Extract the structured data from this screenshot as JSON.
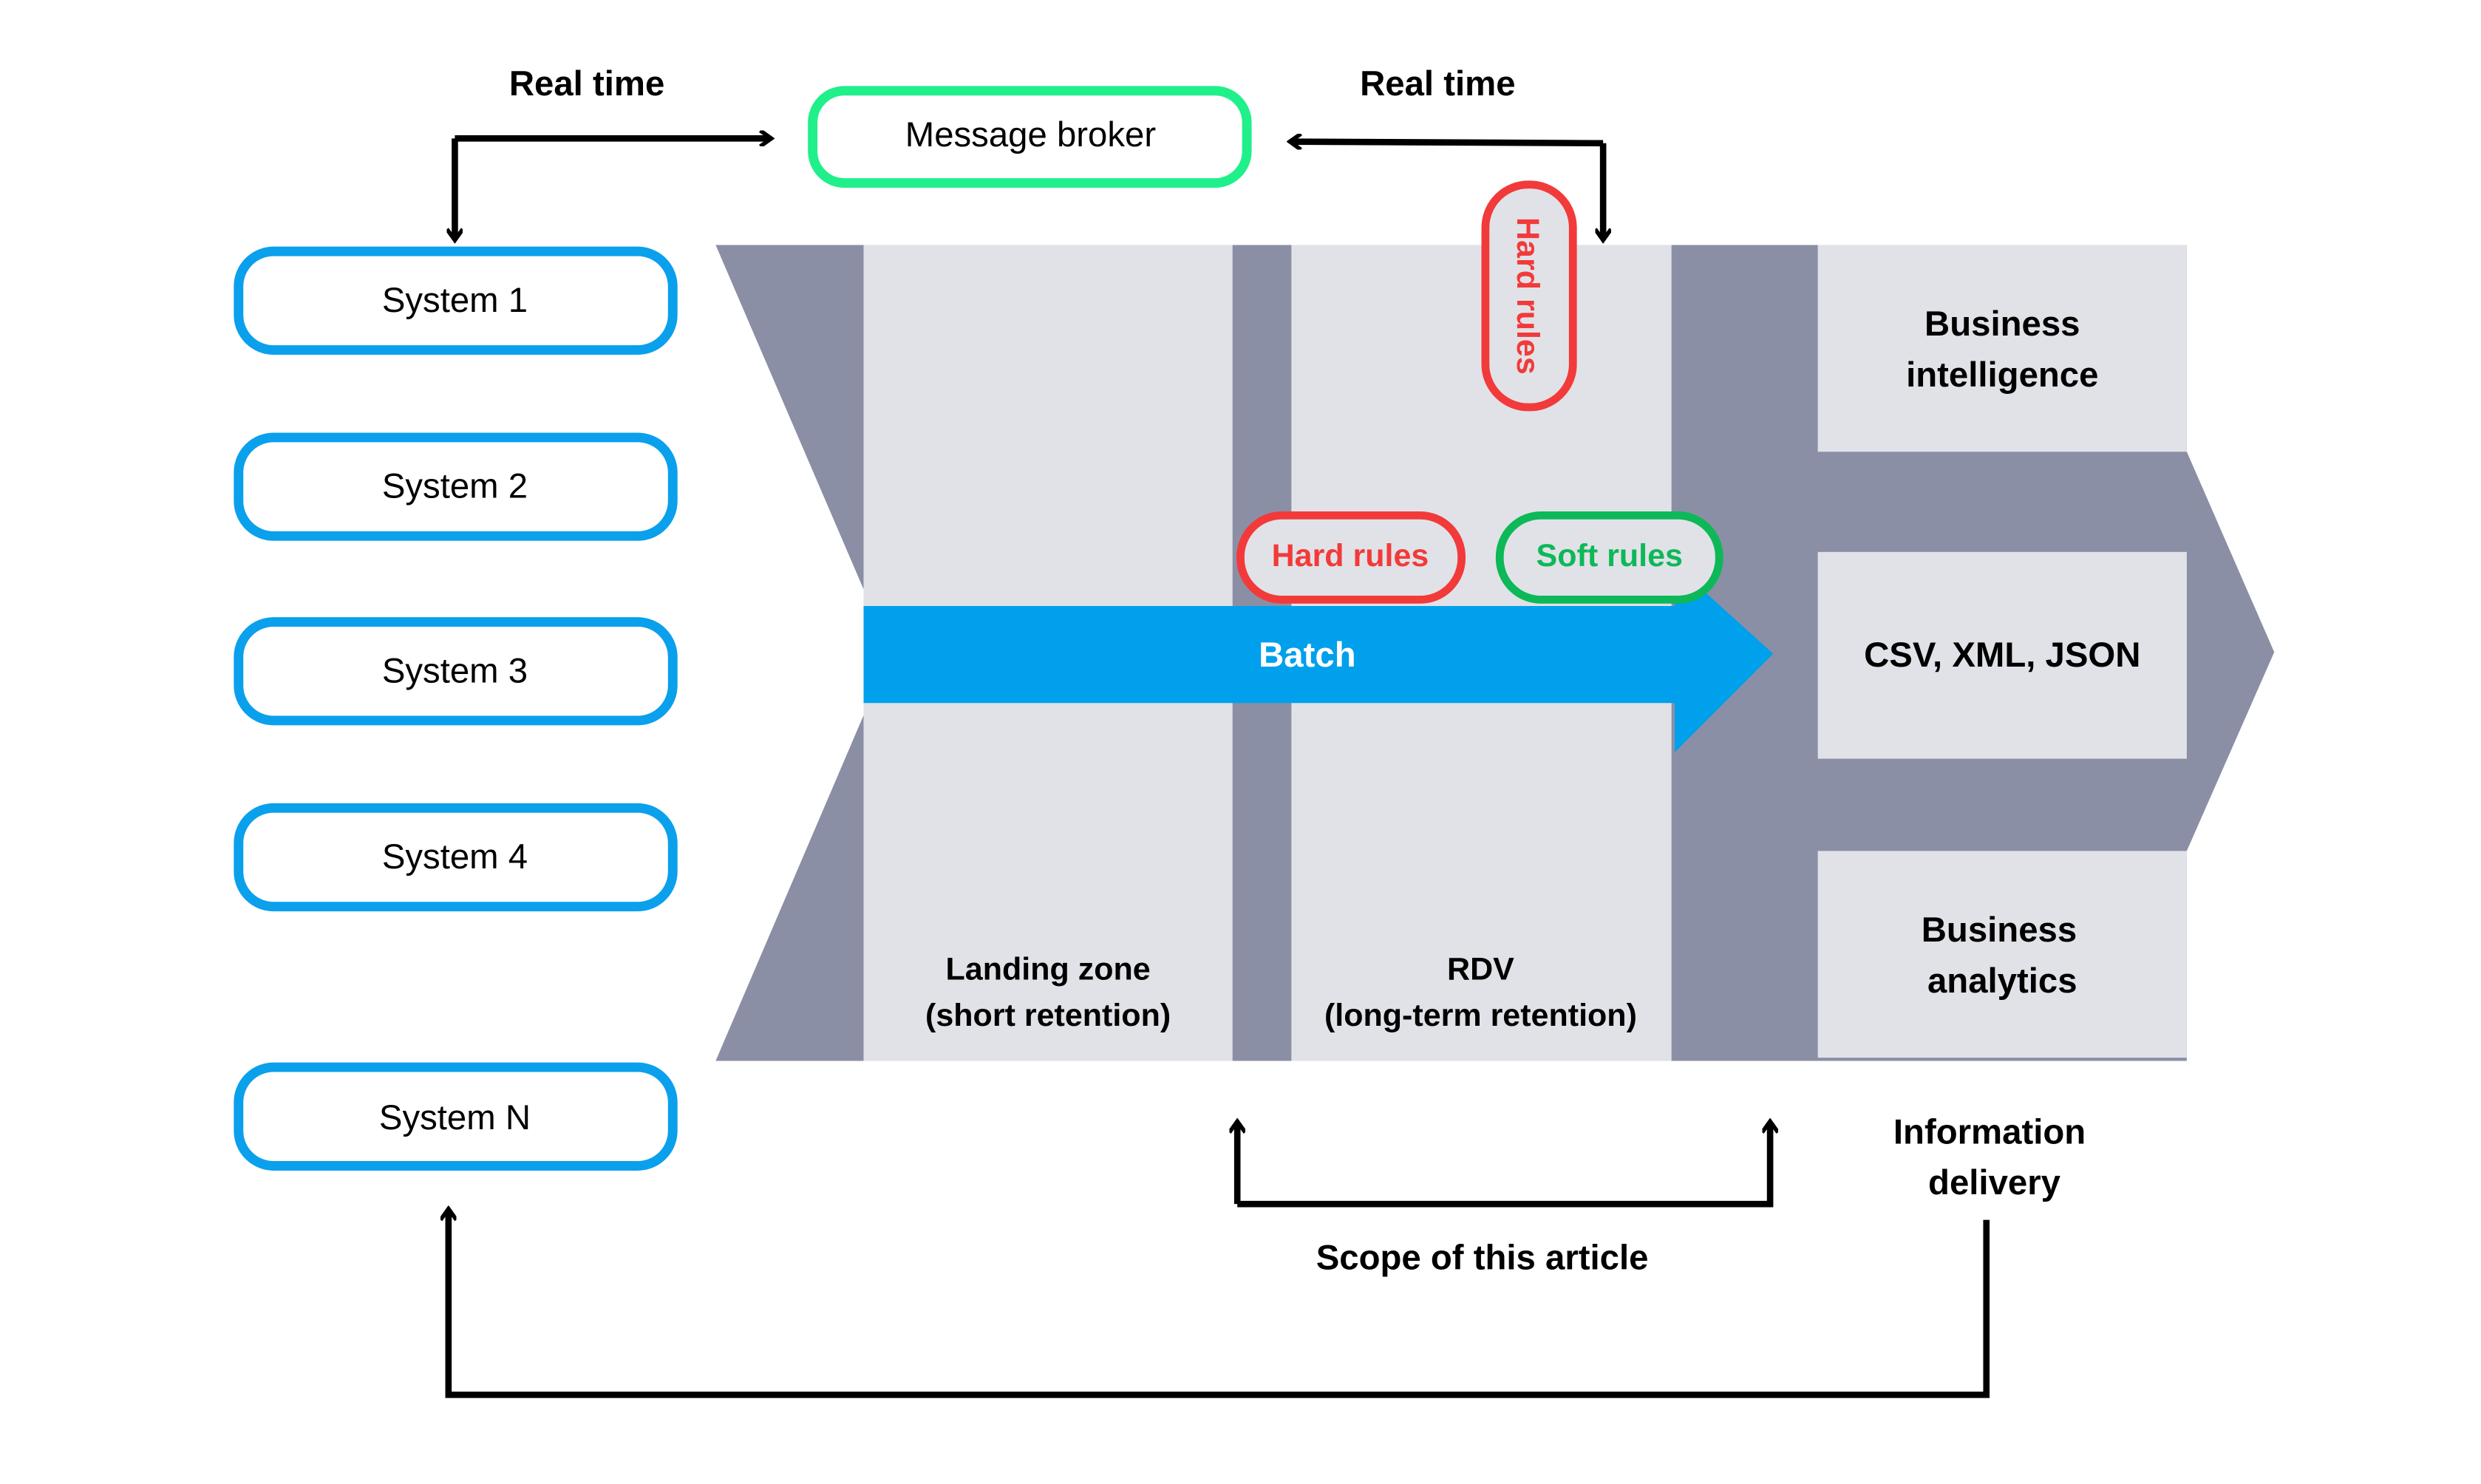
{
  "colors": {
    "chevron": "#8B8FA5",
    "panel": "#E1E2E7",
    "batch": "#00A0EC",
    "system_border": "#0AA0EC",
    "broker_border": "#1FF08A",
    "hard_rules": "#F23A3A",
    "soft_rules": "#0DB858"
  },
  "top": {
    "real_time_left": "Real time",
    "real_time_right": "Real time",
    "message_broker": "Message broker"
  },
  "systems": [
    "System 1",
    "System 2",
    "System 3",
    "System 4",
    "System N"
  ],
  "stages": {
    "landing_line1": "Landing zone",
    "landing_line2": "(short retention)",
    "rdv_line1": "RDV",
    "rdv_line2": "(long-term retention)",
    "batch": "Batch",
    "hard_rules_vertical": "Hard rules",
    "hard_rules": "Hard rules",
    "soft_rules": "Soft rules"
  },
  "outputs": {
    "bi_line1": "Business",
    "bi_line2": "intelligence",
    "formats": "CSV, XML, JSON",
    "ba_line1": "Business",
    "ba_line2": "analytics"
  },
  "bottom": {
    "info_line1": "Information",
    "info_line2": "delivery",
    "scope": "Scope of this article"
  }
}
